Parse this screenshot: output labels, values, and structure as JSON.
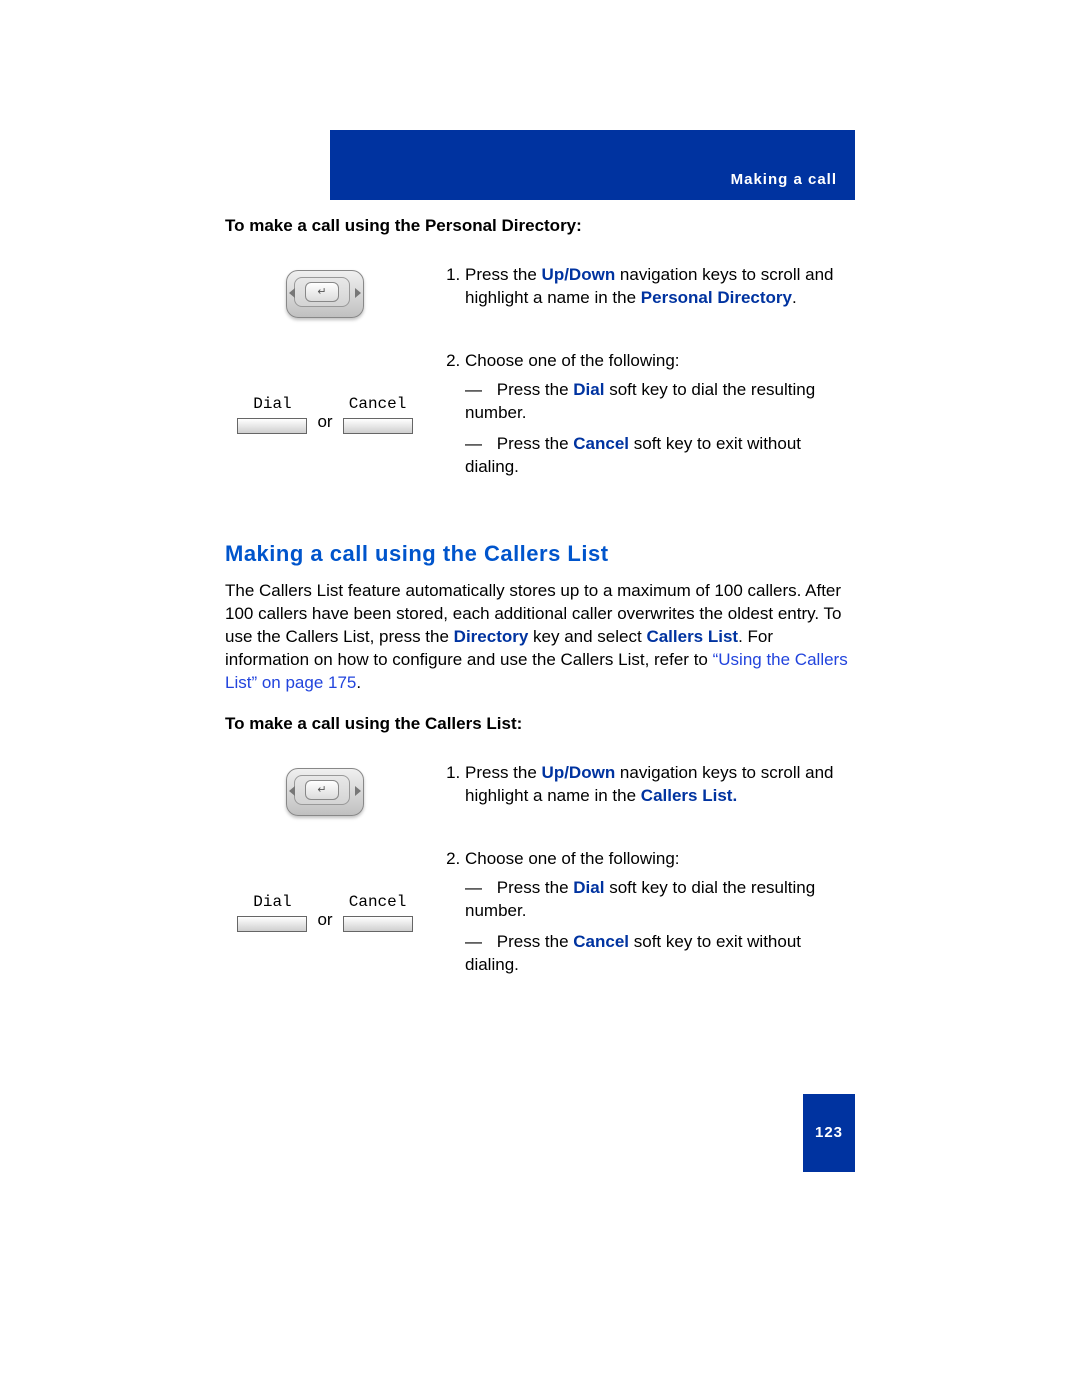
{
  "header": {
    "section_label": "Making a call"
  },
  "intro": {
    "pd_heading": "To make a call using the Personal Directory:"
  },
  "graphics": {
    "or_label": "or",
    "softkey_left": "Dial",
    "softkey_right": "Cancel"
  },
  "pd_steps": {
    "step1_pre": "Press the ",
    "step1_keys": "Up/Down",
    "step1_mid": " navigation keys to scroll and highlight a name in the ",
    "step1_target": "Personal Directory",
    "step1_post": ".",
    "step2_lead": "Choose one of the following:",
    "step2a_pre": "Press the ",
    "step2a_key": "Dial",
    "step2a_post": " soft key to dial the resulting number.",
    "step2b_pre": "Press the ",
    "step2b_key": "Cancel",
    "step2b_post": " soft key to exit without dialing."
  },
  "callers_section": {
    "heading": "Making a call using the Callers List",
    "para_a": "The Callers List feature automatically stores up to a maximum of 100 callers. After 100 callers have been stored, each additional caller overwrites the oldest entry. To use the Callers List, press the ",
    "directory_bold": "Directory",
    "para_b": " key and select ",
    "callers_bold": "Callers List",
    "para_c": ". For information on how to configure and use the Callers List, refer to ",
    "crossref": "“Using the Callers List” on page 175",
    "para_d": ".",
    "cl_heading": "To make a call using the Callers List:"
  },
  "cl_steps": {
    "step1_pre": "Press the ",
    "step1_keys": "Up/Down",
    "step1_mid": " navigation keys to scroll and highlight a name in the ",
    "step1_target": "Callers List.",
    "step2_lead": "Choose one of the following:",
    "step2a_pre": "Press the ",
    "step2a_key": "Dial",
    "step2a_post": " soft key to dial the resulting number.",
    "step2b_pre": "Press the ",
    "step2b_key": "Cancel",
    "step2b_post": " soft key to exit without dialing."
  },
  "footer": {
    "page_number": "123"
  }
}
